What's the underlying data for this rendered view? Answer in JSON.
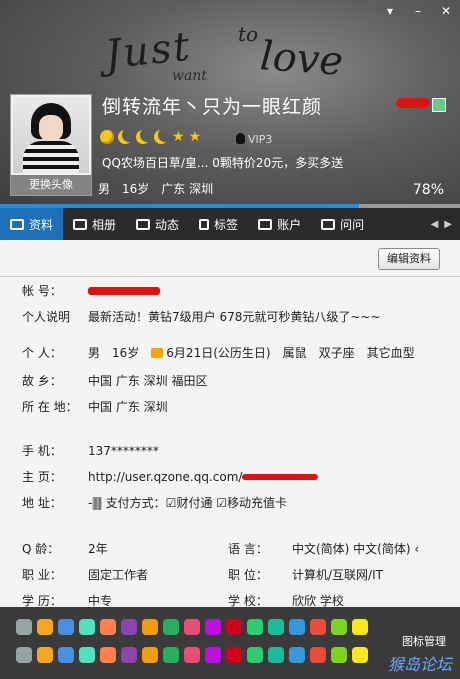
{
  "window": {
    "controls": [
      "▾",
      "–",
      "✕"
    ]
  },
  "banner": {
    "line1": "Just",
    "line2": "to",
    "line3": "love",
    "line4": "want"
  },
  "profile": {
    "avatar_button": "更换头像",
    "nickname": "倒转流年丶只为一眼红颜",
    "vip_label": "VIP3",
    "promo": "QQ农场百日草/皇... 0颗特价20元，多买多送",
    "gender": "男",
    "age": "16岁",
    "location": "广东  深圳",
    "completion": "78%",
    "completion_value": 0.78
  },
  "tabs": [
    {
      "label": "资料",
      "icon": "profile-card-icon"
    },
    {
      "label": "相册",
      "icon": "album-icon"
    },
    {
      "label": "动态",
      "icon": "feed-icon"
    },
    {
      "label": "标签",
      "icon": "bookmark-icon"
    },
    {
      "label": "账户",
      "icon": "account-icon"
    },
    {
      "label": "问问",
      "icon": "question-icon"
    }
  ],
  "edit_button": "编辑资料",
  "fields": {
    "account": {
      "label": "帐      号："
    },
    "signature": {
      "label": "个人说明",
      "value": "最新活动！黄钻7级用户 678元就可秒黄钻八级了~~~"
    },
    "personal": {
      "label": "个      人：",
      "gender": "男",
      "age": "16岁",
      "birthday": "6月21日(公历生日)",
      "zodiac": "属鼠",
      "constellation": "双子座",
      "blood": "其它血型"
    },
    "hometown": {
      "label": "故      乡：",
      "value": "中国  广东  深圳  福田区"
    },
    "residence": {
      "label": "所 在 地：",
      "value": "中国  广东  深圳"
    },
    "mobile": {
      "label": "手      机：",
      "value": "137********"
    },
    "homepage": {
      "label": "主      页：",
      "value": "http://user.qzone.qq.com/"
    },
    "address": {
      "label": "地      址：",
      "value": "-🀫 支付方式：☑财付通  ☑移动充值卡"
    },
    "qage": {
      "label": "Q      龄：",
      "value": "2年"
    },
    "language": {
      "label": "语      言：",
      "value": "中文(简体)  中文(简体)  ‹"
    },
    "occupation": {
      "label": "职      业：",
      "value": "固定工作者"
    },
    "position": {
      "label": "职      位：",
      "value": "计算机/互联网/IT"
    },
    "education": {
      "label": "学      历：",
      "value": "中专"
    },
    "school": {
      "label": "学      校：",
      "value": "欣欣 学校"
    }
  },
  "footer": {
    "icon_manager": "图标管理",
    "watermark": "猴岛论坛"
  },
  "colors": {
    "accent": "#1d6fba",
    "progress": "#1e8fe0",
    "redact": "#e21111"
  }
}
